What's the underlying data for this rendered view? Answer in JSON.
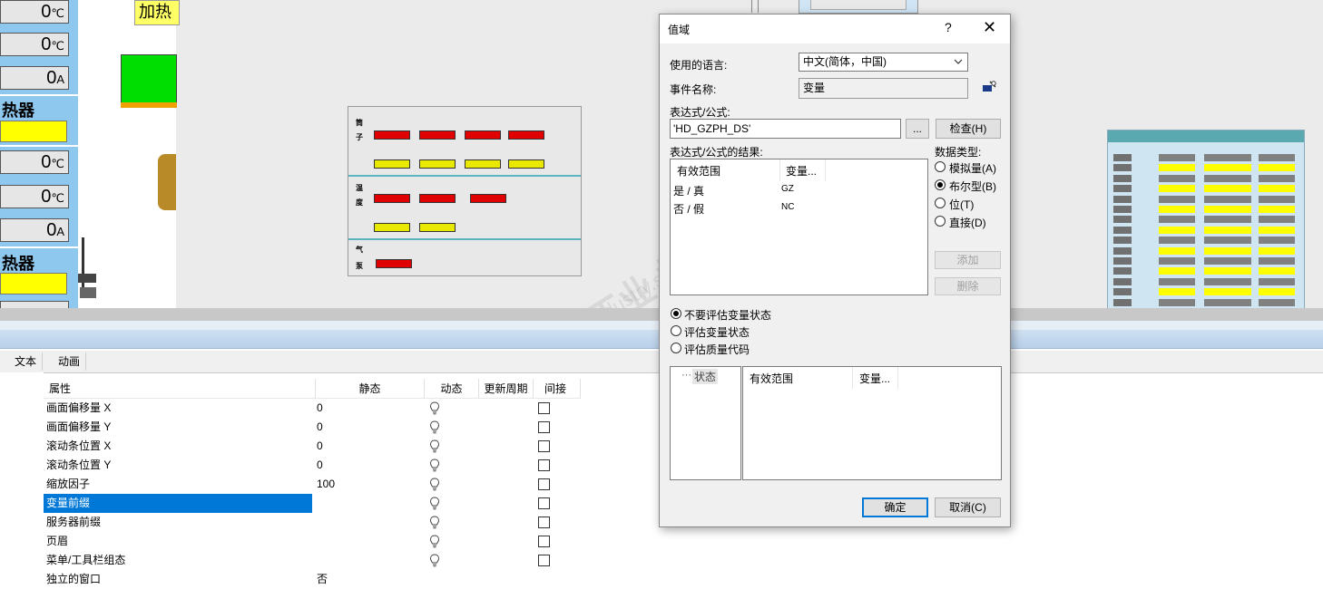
{
  "canvas": {
    "left_cells": [
      {
        "value": "0",
        "unit": "℃"
      },
      {
        "value": "0",
        "unit": "℃"
      },
      {
        "value": "0",
        "unit": "A"
      },
      {
        "value": "0",
        "unit": "℃"
      },
      {
        "value": "0",
        "unit": "℃"
      },
      {
        "value": "0",
        "unit": "A"
      }
    ],
    "heater_labels": [
      "热器",
      "热器"
    ],
    "heat_top_label": "加热"
  },
  "dialog": {
    "title": "值域",
    "help": "?",
    "close": "✕",
    "language_label": "使用的语言:",
    "language_value": "中文(简体，中国)",
    "event_label": "事件名称:",
    "event_value": "变量",
    "expr_label": "表达式/公式:",
    "expr_value": "'HD_GZPH_DS'",
    "browse_label": "...",
    "check_label": "检查(H)",
    "result_label": "表达式/公式的结果:",
    "result_header_range": "有效范围",
    "result_header_var": "变量...",
    "result_rows": [
      {
        "range": "是 / 真",
        "var": "GZ"
      },
      {
        "range": "否 / 假",
        "var": "NC"
      }
    ],
    "datatype_label": "数据类型:",
    "datatypes": [
      {
        "label": "模拟量(A)",
        "selected": false
      },
      {
        "label": "布尔型(B)",
        "selected": true
      },
      {
        "label": "位(T)",
        "selected": false
      },
      {
        "label": "直接(D)",
        "selected": false
      }
    ],
    "add_label": "添加",
    "delete_label": "删除",
    "eval_options": [
      {
        "label": "不要评估变量状态",
        "selected": true
      },
      {
        "label": "评估变量状态",
        "selected": false
      },
      {
        "label": "评估质量代码",
        "selected": false
      }
    ],
    "status_tree_item": "状态",
    "status_header_range": "有效范围",
    "status_header_var": "变量...",
    "ok_label": "确定",
    "cancel_label": "取消(C)"
  },
  "lower": {
    "tabs": [
      "文本",
      "动画"
    ],
    "headers": {
      "property": "属性",
      "static": "静态",
      "dynamic": "动态",
      "cycle": "更新周期",
      "indirect": "间接"
    },
    "rows": [
      {
        "name": "画面偏移量  X",
        "static": "0",
        "selected": false
      },
      {
        "name": "画面偏移量  Y",
        "static": "0",
        "selected": false
      },
      {
        "name": "滚动条位置 X",
        "static": "0",
        "selected": false
      },
      {
        "name": "滚动条位置 Y",
        "static": "0",
        "selected": false
      },
      {
        "name": "缩放因子",
        "static": "100",
        "selected": false
      },
      {
        "name": "变量前缀",
        "static": "",
        "selected": true
      },
      {
        "name": "服务器前缀",
        "static": "",
        "selected": false
      },
      {
        "name": "页眉",
        "static": "",
        "selected": false
      },
      {
        "name": "菜单/工具栏组态",
        "static": "",
        "selected": false
      },
      {
        "name": "独立的窗口",
        "static": "否",
        "selected": false
      }
    ]
  },
  "watermark": {
    "text": "西门子工业 技术论坛",
    "url": "support.industry.siemens.com/cs"
  },
  "colors": {
    "accent": "#0078d7",
    "alarm_red": "#e00000",
    "status_yellow": "#ffff00",
    "status_green": "#00dd00"
  }
}
